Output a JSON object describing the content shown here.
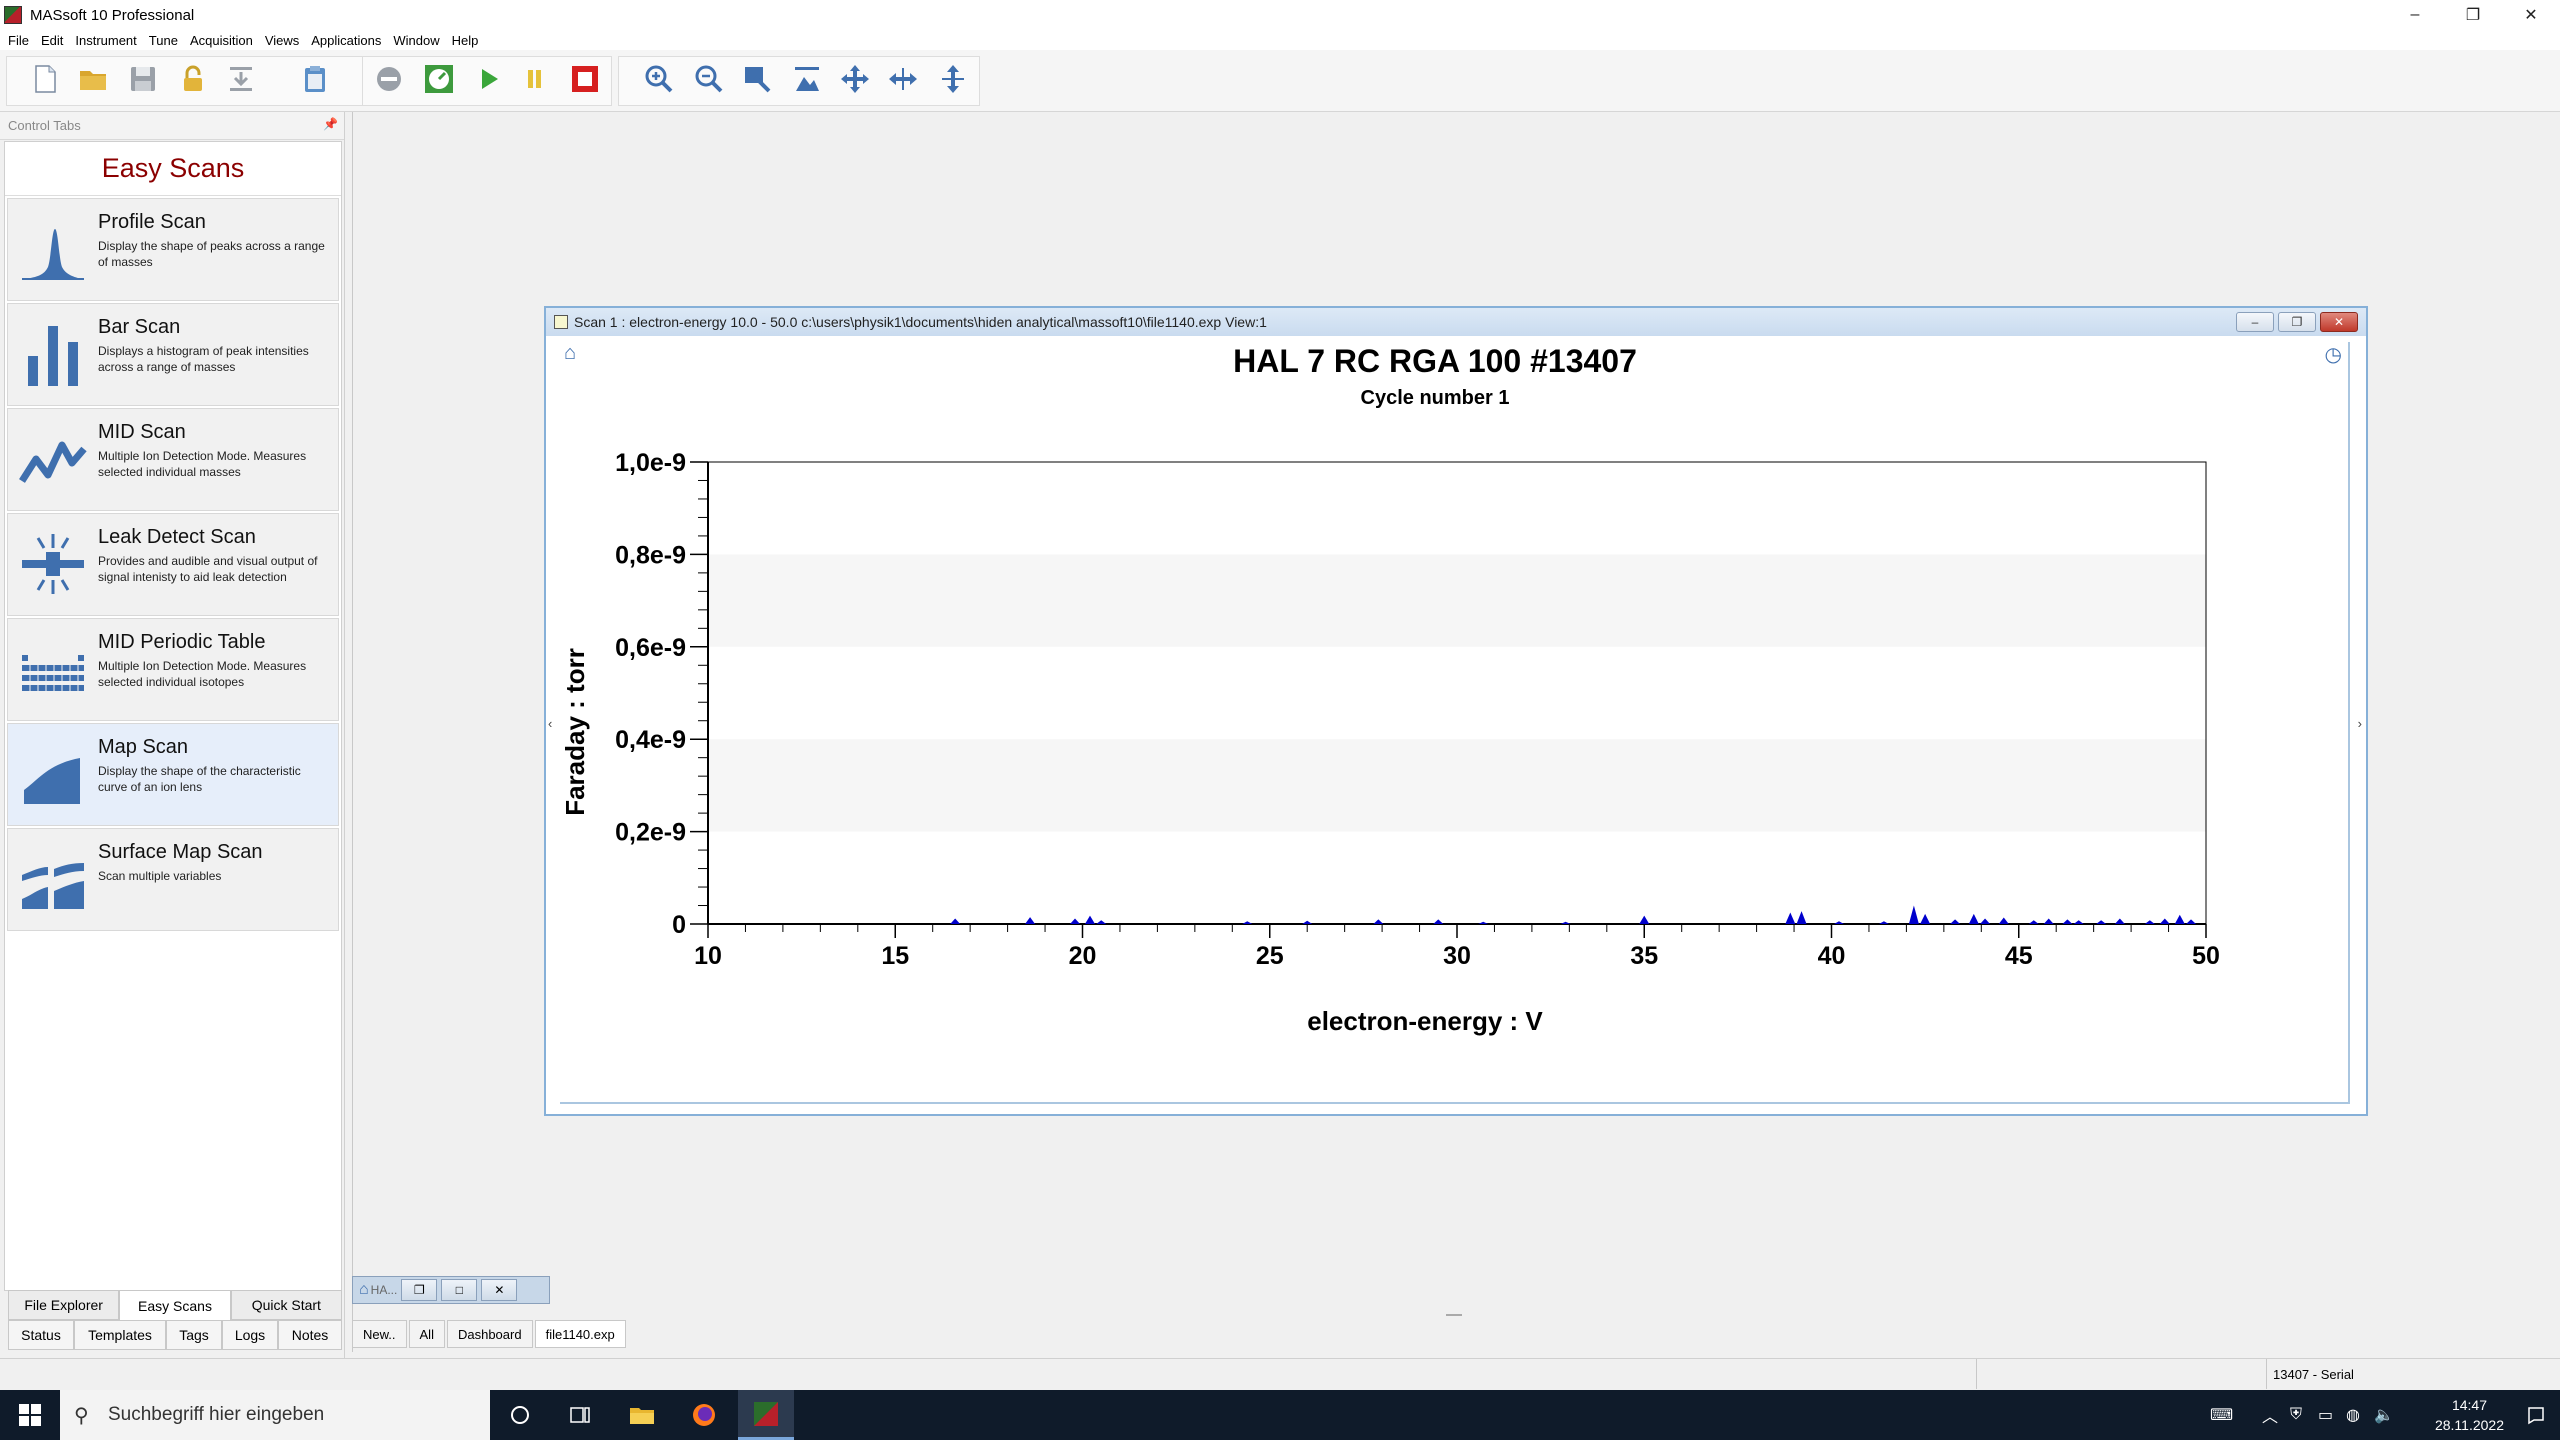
{
  "app": {
    "title": "MASsoft 10 Professional"
  },
  "window_controls": {
    "minimize": "–",
    "restore": "❐",
    "close": "✕"
  },
  "menu": [
    "File",
    "Edit",
    "Instrument",
    "Tune",
    "Acquisition",
    "Views",
    "Applications",
    "Window",
    "Help"
  ],
  "left_panel": {
    "header": "Control Tabs",
    "pin": "📌",
    "easy_scans_title": "Easy Scans",
    "scans": [
      {
        "name": "Profile Scan",
        "desc": "Display the shape of peaks across a range of masses"
      },
      {
        "name": "Bar Scan",
        "desc": "Displays a histogram of peak intensities across a range of masses"
      },
      {
        "name": "MID Scan",
        "desc": "Multiple Ion Detection Mode. Measures selected individual masses"
      },
      {
        "name": "Leak Detect Scan",
        "desc": "Provides and audible and visual output of signal intenisty to aid leak detection"
      },
      {
        "name": "MID Periodic Table",
        "desc": "Multiple Ion Detection Mode. Measures selected individual isotopes"
      },
      {
        "name": "Map Scan",
        "desc": "Display the shape of the characteristic curve of an ion lens"
      },
      {
        "name": "Surface Map Scan",
        "desc": "Scan multiple variables"
      }
    ],
    "tabs_row1": [
      "File Explorer",
      "Easy Scans",
      "Quick Start"
    ],
    "tabs_row2": [
      "Status",
      "Templates",
      "Tags",
      "Logs",
      "Notes"
    ]
  },
  "scan_window": {
    "title": "Scan 1 : electron-energy 10.0 - 50.0 c:\\users\\physik1\\documents\\hiden analytical\\massoft10\\file1140.exp View:1",
    "home_icon": "⌂",
    "history_icon": "◷",
    "left_arrow": "‹",
    "right_arrow": "›"
  },
  "chart_data": {
    "type": "line",
    "title": "HAL 7 RC RGA 100 #13407",
    "subtitle": "Cycle number 1",
    "xlabel": "electron-energy : V",
    "ylabel": "Faraday : torr",
    "xlim": [
      10,
      50
    ],
    "ylim": [
      0,
      1e-09
    ],
    "x_ticks": [
      "10",
      "15",
      "20",
      "25",
      "30",
      "35",
      "40",
      "45",
      "50"
    ],
    "y_ticks": [
      "0",
      "0,2e-9",
      "0,4e-9",
      "0,6e-9",
      "0,8e-9",
      "1,0e-9"
    ],
    "series": [
      {
        "color": "#0000cc",
        "peaks": [
          [
            16.6,
            1.2e-11
          ],
          [
            18.6,
            1.5e-11
          ],
          [
            19.8,
            1.2e-11
          ],
          [
            20.2,
            1.8e-11
          ],
          [
            20.5,
            8e-12
          ],
          [
            24.4,
            6e-12
          ],
          [
            26.0,
            7e-12
          ],
          [
            27.9,
            1e-11
          ],
          [
            29.5,
            1e-11
          ],
          [
            30.7,
            5e-12
          ],
          [
            32.9,
            5e-12
          ],
          [
            35.0,
            1.8e-11
          ],
          [
            38.9,
            2.5e-11
          ],
          [
            39.2,
            2.8e-11
          ],
          [
            40.2,
            6e-12
          ],
          [
            41.4,
            6e-12
          ],
          [
            42.2,
            4e-11
          ],
          [
            42.5,
            2.2e-11
          ],
          [
            43.3,
            1e-11
          ],
          [
            43.8,
            2.2e-11
          ],
          [
            44.1,
            1.2e-11
          ],
          [
            44.6,
            1.4e-11
          ],
          [
            45.4,
            8e-12
          ],
          [
            45.8,
            1.2e-11
          ],
          [
            46.3,
            1e-11
          ],
          [
            46.6,
            8e-12
          ],
          [
            47.2,
            8e-12
          ],
          [
            47.7,
            1.2e-11
          ],
          [
            48.5,
            8e-12
          ],
          [
            48.9,
            1.2e-11
          ],
          [
            49.3,
            2e-11
          ],
          [
            49.6,
            1e-11
          ]
        ]
      }
    ],
    "grid": "horizontal bands"
  },
  "mini_window": {
    "label": "HA..."
  },
  "doc_tabs": [
    "New..",
    "All",
    "Dashboard",
    "file1140.exp"
  ],
  "status": {
    "serial": "13407 - Serial"
  },
  "taskbar": {
    "search_placeholder": "Suchbegriff hier eingeben",
    "time": "14:47",
    "date": "28.11.2022"
  }
}
